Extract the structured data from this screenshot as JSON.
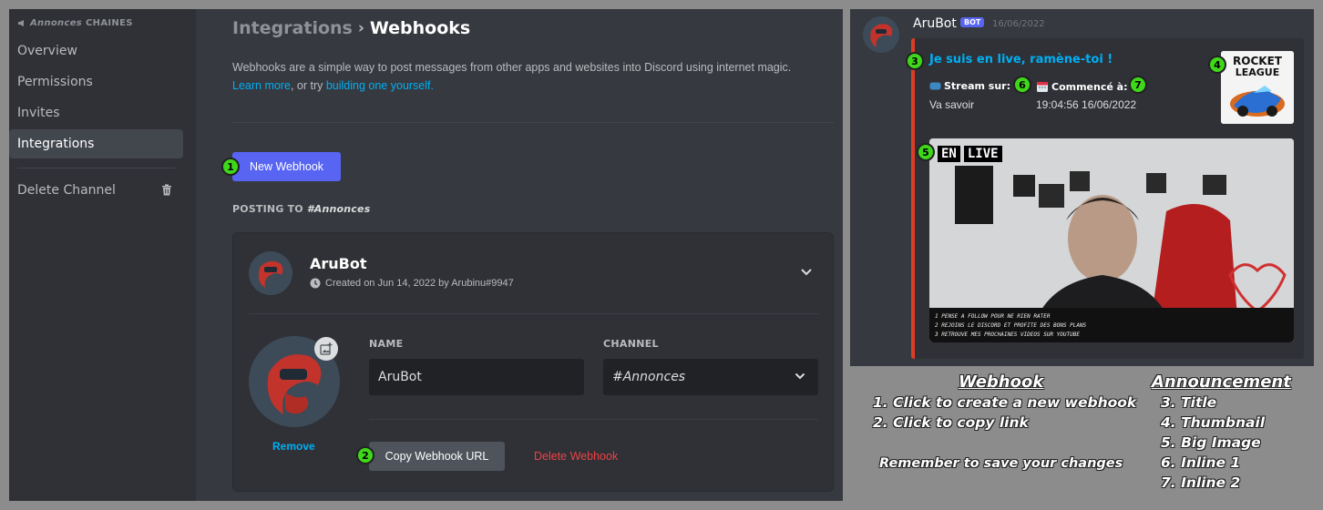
{
  "sidebar": {
    "category_name": "Annonces",
    "category_suffix": "CHAINES",
    "items": [
      {
        "label": "Overview"
      },
      {
        "label": "Permissions"
      },
      {
        "label": "Invites"
      },
      {
        "label": "Integrations"
      }
    ],
    "delete_label": "Delete Channel"
  },
  "main": {
    "crumb_parent": "Integrations",
    "crumb_sep": "›",
    "crumb_current": "Webhooks",
    "description": "Webhooks are a simple way to post messages from other apps and websites into Discord using internet magic.",
    "learn_more": "Learn more",
    "or_try": ", or try ",
    "build_link": "building one yourself.",
    "new_webhook": "New Webhook",
    "posting_to": "POSTING TO",
    "posting_channel": "#Annonces"
  },
  "webhook": {
    "name": "AruBot",
    "created": "Created on Jun 14, 2022 by Arubinu#9947",
    "remove": "Remove",
    "name_label": "NAME",
    "name_value": "AruBot",
    "channel_label": "CHANNEL",
    "channel_value": "#Annonces",
    "copy_url": "Copy Webhook URL",
    "delete": "Delete Webhook"
  },
  "badges": [
    "1",
    "2",
    "3",
    "4",
    "5",
    "6",
    "7"
  ],
  "preview": {
    "author": "AruBot",
    "bot_tag": "BOT",
    "date": "16/06/2022",
    "title": "Je suis en live, ramène-toi !",
    "field1_name": "Stream sur:",
    "field1_value": "Va savoir",
    "field2_name": "Commencé à:",
    "field2_value": "19:04:56 16/06/2022",
    "thumb_text_1": "ROCKET",
    "thumb_text_2": "LEAGUE",
    "live_1": "EN",
    "live_2": "LIVE",
    "image_lines": [
      "1  PENSE A FOLLOW POUR NE RIEN RATER",
      "2  REJOINS LE DISCORD ET PROFITE DES BONS PLANS",
      "3  RETROUVE MES PROCHAINES VIDEOS SUR YOUTUBE"
    ],
    "embed_color": "#e03b24"
  },
  "legend": {
    "webhook_head": "Webhook",
    "webhook_items": [
      "1. Click to create a new webhook",
      "2. Click to copy link"
    ],
    "reminder": "Remember to save your changes",
    "announce_head": "Announcement",
    "announce_items": [
      "3. Title",
      "4. Thumbnail",
      "5. Big Image",
      "6. Inline 1",
      "7. Inline 2"
    ]
  },
  "colors": {
    "blurple": "#5865f2",
    "link": "#00aff4",
    "danger": "#ed4245",
    "badge": "#3fd71a"
  },
  "icons": [
    "megaphone-icon",
    "trash-icon",
    "clock-icon",
    "chevron-down-icon",
    "image-upload-icon",
    "stream-icon",
    "calendar-icon"
  ]
}
